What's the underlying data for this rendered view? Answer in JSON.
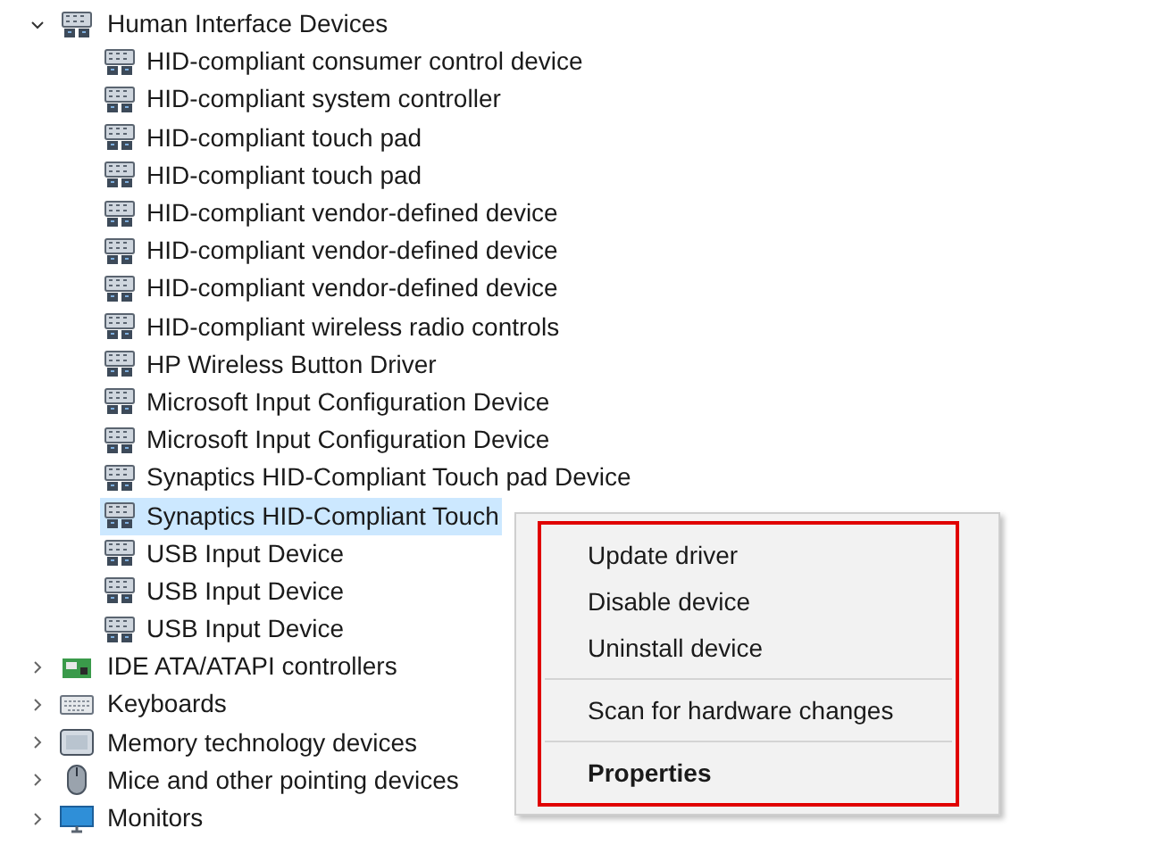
{
  "tree": [
    {
      "label": "Human Interface Devices",
      "kind": "hid",
      "expanded": true,
      "children": [
        {
          "label": "HID-compliant consumer control device",
          "selected": false
        },
        {
          "label": "HID-compliant system controller",
          "selected": false
        },
        {
          "label": "HID-compliant touch pad",
          "selected": false
        },
        {
          "label": "HID-compliant touch pad",
          "selected": false
        },
        {
          "label": "HID-compliant vendor-defined device",
          "selected": false
        },
        {
          "label": "HID-compliant vendor-defined device",
          "selected": false
        },
        {
          "label": "HID-compliant vendor-defined device",
          "selected": false
        },
        {
          "label": "HID-compliant wireless radio controls",
          "selected": false
        },
        {
          "label": "HP Wireless Button Driver",
          "selected": false
        },
        {
          "label": "Microsoft Input Configuration Device",
          "selected": false
        },
        {
          "label": "Microsoft Input Configuration Device",
          "selected": false
        },
        {
          "label": "Synaptics HID-Compliant Touch pad Device",
          "selected": false
        },
        {
          "label": "Synaptics HID-Compliant Touch",
          "selected": true
        },
        {
          "label": "USB Input Device",
          "selected": false
        },
        {
          "label": "USB Input Device",
          "selected": false
        },
        {
          "label": "USB Input Device",
          "selected": false
        }
      ]
    },
    {
      "label": "IDE ATA/ATAPI controllers",
      "kind": "ide",
      "expanded": false
    },
    {
      "label": "Keyboards",
      "kind": "keyboard",
      "expanded": false
    },
    {
      "label": "Memory technology devices",
      "kind": "memory",
      "expanded": false
    },
    {
      "label": "Mice and other pointing devices",
      "kind": "mouse",
      "expanded": false
    },
    {
      "label": "Monitors",
      "kind": "monitor",
      "expanded": false
    }
  ],
  "context_menu": {
    "highlighted": true,
    "items": [
      {
        "kind": "item",
        "label": "Update driver",
        "bold": false
      },
      {
        "kind": "item",
        "label": "Disable device",
        "bold": false
      },
      {
        "kind": "item",
        "label": "Uninstall device",
        "bold": false
      },
      {
        "kind": "separator"
      },
      {
        "kind": "item",
        "label": "Scan for hardware changes",
        "bold": false
      },
      {
        "kind": "separator"
      },
      {
        "kind": "item",
        "label": "Properties",
        "bold": true
      }
    ]
  }
}
